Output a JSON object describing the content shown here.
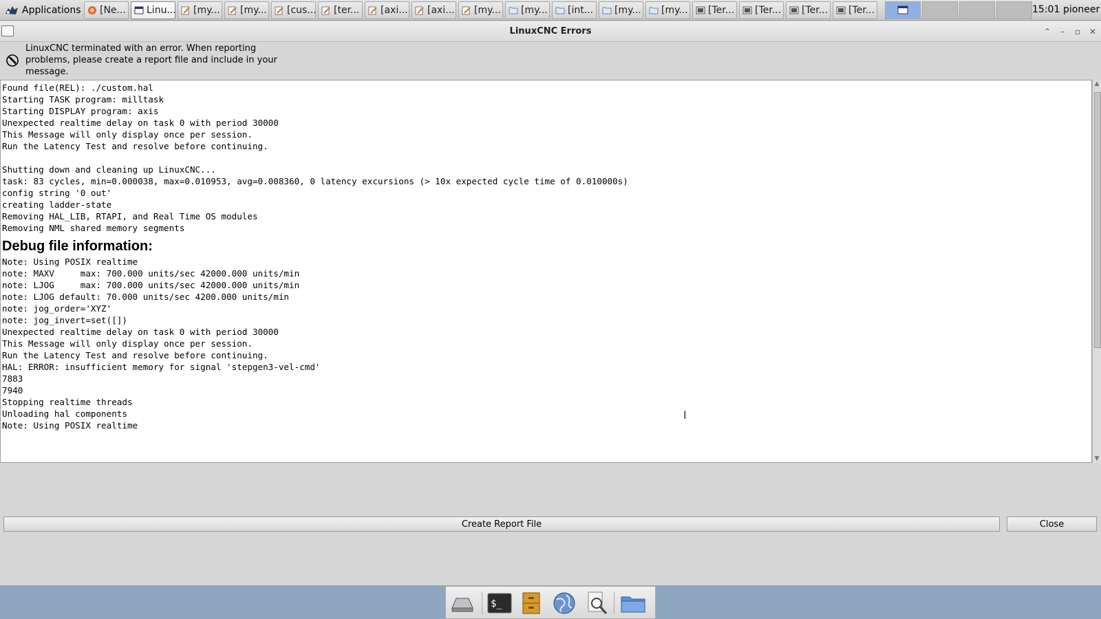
{
  "panel": {
    "applications_label": "Applications",
    "tasks": [
      {
        "label": "[Ne...",
        "icon": "firefox-icon"
      },
      {
        "label": "Linu...",
        "icon": "window-icon"
      },
      {
        "label": "[my...",
        "icon": "text-editor-icon"
      },
      {
        "label": "[my...",
        "icon": "text-editor-icon"
      },
      {
        "label": "[cus...",
        "icon": "text-editor-icon"
      },
      {
        "label": "[ter...",
        "icon": "text-editor-icon"
      },
      {
        "label": "[axi...",
        "icon": "text-editor-icon"
      },
      {
        "label": "[axi...",
        "icon": "text-editor-icon"
      },
      {
        "label": "[my...",
        "icon": "text-editor-icon"
      },
      {
        "label": "[my...",
        "icon": "folder-icon"
      },
      {
        "label": "[int...",
        "icon": "folder-icon"
      },
      {
        "label": "[my...",
        "icon": "folder-icon"
      },
      {
        "label": "[my...",
        "icon": "folder-icon"
      },
      {
        "label": "[Ter...",
        "icon": "terminal-icon"
      },
      {
        "label": "[Ter...",
        "icon": "terminal-icon"
      },
      {
        "label": "[Ter...",
        "icon": "terminal-icon"
      },
      {
        "label": "[Ter...",
        "icon": "terminal-icon"
      }
    ],
    "clock": "15:01",
    "user": "pioneer"
  },
  "window": {
    "title": "LinuxCNC Errors"
  },
  "header": {
    "message": "LinuxCNC terminated with an error.  When reporting problems, please create a report file and include in your message."
  },
  "log": {
    "lines_before": "Found file(REL): ./custom.hal\nStarting TASK program: milltask\nStarting DISPLAY program: axis\nUnexpected realtime delay on task 0 with period 30000\nThis Message will only display once per session.\nRun the Latency Test and resolve before continuing.\n\nShutting down and cleaning up LinuxCNC...\ntask: 83 cycles, min=0.000038, max=0.010953, avg=0.008360, 0 latency excursions (> 10x expected cycle time of 0.010000s)\nconfig string '0 out'\ncreating ladder-state\nRemoving HAL_LIB, RTAPI, and Real Time OS modules\nRemoving NML shared memory segments",
    "debug_heading": "Debug file information:",
    "lines_after": "Note: Using POSIX realtime\nnote: MAXV     max: 700.000 units/sec 42000.000 units/min\nnote: LJOG     max: 700.000 units/sec 42000.000 units/min\nnote: LJOG default: 70.000 units/sec 4200.000 units/min\nnote: jog_order='XYZ'\nnote: jog_invert=set([])\nUnexpected realtime delay on task 0 with period 30000\nThis Message will only display once per session.\nRun the Latency Test and resolve before continuing.\nHAL: ERROR: insufficient memory for signal 'stepgen3-vel-cmd'\n7883\n7940\nStopping realtime threads\nUnloading hal components\nNote: Using POSIX realtime"
  },
  "buttons": {
    "create_report": "Create Report File",
    "close": "Close"
  },
  "dock": {
    "items": [
      "drive-icon",
      "terminal-icon",
      "file-cabinet-icon",
      "web-browser-icon",
      "search-icon",
      "folder-icon"
    ]
  }
}
